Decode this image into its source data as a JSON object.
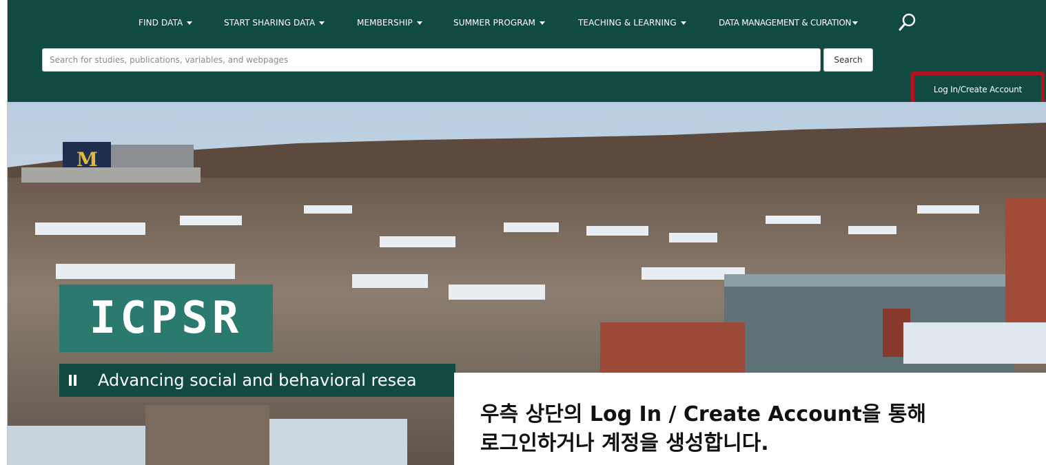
{
  "nav": {
    "items": [
      {
        "label": "FIND DATA"
      },
      {
        "label": "START SHARING DATA"
      },
      {
        "label": "MEMBERSHIP"
      },
      {
        "label": "SUMMER PROGRAM"
      },
      {
        "label": "TEACHING & LEARNING"
      },
      {
        "label": "DATA MANAGEMENT & CURATION"
      }
    ],
    "search_icon": "magnifier-icon"
  },
  "search": {
    "placeholder": "Search for studies, publications, variables, and webpages",
    "button_label": "Search"
  },
  "account": {
    "login_label": "Log In/Create Account",
    "highlight_color": "#b5121b"
  },
  "hero": {
    "logo_text": "ICPSR",
    "tagline": "Advancing social and behavioral resea",
    "pause_icon": "pause-icon",
    "caption_line1": "우측 상단의 Log In / Create Account을 통해",
    "caption_line2": "로그인하거나 계정을 생성합니다."
  },
  "colors": {
    "header_bg": "#114a40",
    "logo_bg": "#2a7a70"
  }
}
